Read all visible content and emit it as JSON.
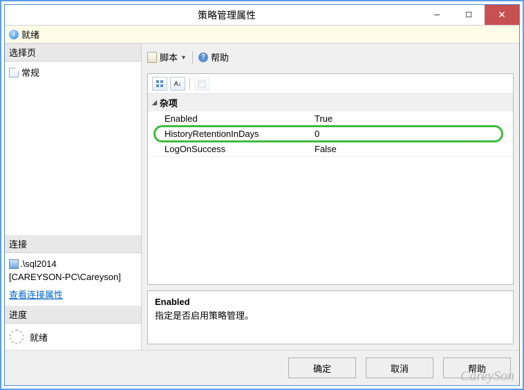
{
  "window": {
    "title": "策略管理属性"
  },
  "status": {
    "text": "就绪"
  },
  "left": {
    "select_page": {
      "header": "选择页",
      "items": [
        "常规"
      ]
    },
    "connection": {
      "header": "连接",
      "server": ".\\sql2014",
      "user": "[CAREYSON-PC\\Careyson]",
      "view_props": "查看连接属性"
    },
    "progress": {
      "header": "进度",
      "text": "就绪"
    }
  },
  "toolbar": {
    "script": "脚本",
    "help": "帮助"
  },
  "properties": {
    "category": "杂项",
    "rows": [
      {
        "key": "Enabled",
        "val": "True"
      },
      {
        "key": "HistoryRetentionInDays",
        "val": "0"
      },
      {
        "key": "LogOnSuccess",
        "val": "False"
      }
    ]
  },
  "description": {
    "title": "Enabled",
    "text": "指定是否启用策略管理。"
  },
  "buttons": {
    "ok": "确定",
    "cancel": "取消",
    "help": "帮助"
  },
  "watermark": "CareySon"
}
